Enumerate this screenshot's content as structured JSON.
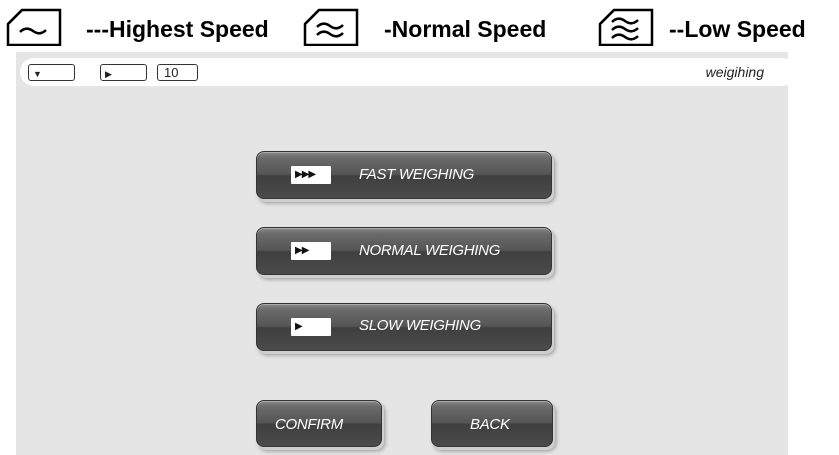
{
  "legend": {
    "highest": {
      "icon": "highest-speed-icon",
      "label": "---Highest Speed"
    },
    "normal": {
      "icon": "normal-speed-icon",
      "label": "-Normal Speed"
    },
    "low": {
      "icon": "low-speed-icon",
      "label": "--Low Speed"
    }
  },
  "status_bar": {
    "box1_glyph": "▼",
    "box2_glyph": "▶",
    "box3_value": "10",
    "title": "weigihing"
  },
  "menu": {
    "fast": {
      "label": "FAST WEIGHING",
      "speed_glyph": "▶▶▶"
    },
    "normal": {
      "label": "NORMAL WEIGHING",
      "speed_glyph": "▶▶"
    },
    "slow": {
      "label": "SLOW WEIGHING",
      "speed_glyph": "▶"
    }
  },
  "actions": {
    "confirm_label": "CONFIRM",
    "back_label": "BACK"
  },
  "colors": {
    "screen_bg": "#e5e5e5",
    "button_dark": "#4b4b4b",
    "button_text": "#ffffff"
  }
}
